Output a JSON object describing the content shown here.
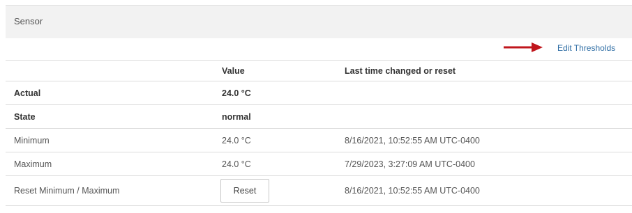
{
  "panel": {
    "title": "Sensor",
    "edit_thresholds_link": "Edit Thresholds"
  },
  "icons": {
    "arrow": "right-arrow-icon",
    "arrow_color": "#c0161c"
  },
  "table": {
    "headers": [
      "",
      "Value",
      "Last time changed or reset"
    ],
    "rows": [
      {
        "label": "Actual",
        "value": "24.0 °C",
        "changed": ""
      },
      {
        "label": "State",
        "value": "normal",
        "changed": ""
      },
      {
        "label": "Minimum",
        "value": "24.0 °C",
        "changed": "8/16/2021, 10:52:55 AM UTC-0400"
      },
      {
        "label": "Maximum",
        "value": "24.0 °C",
        "changed": "7/29/2023, 3:27:09 AM UTC-0400"
      },
      {
        "label": "Reset Minimum / Maximum",
        "button_label": "Reset",
        "changed": "8/16/2021, 10:52:55 AM UTC-0400"
      }
    ]
  }
}
